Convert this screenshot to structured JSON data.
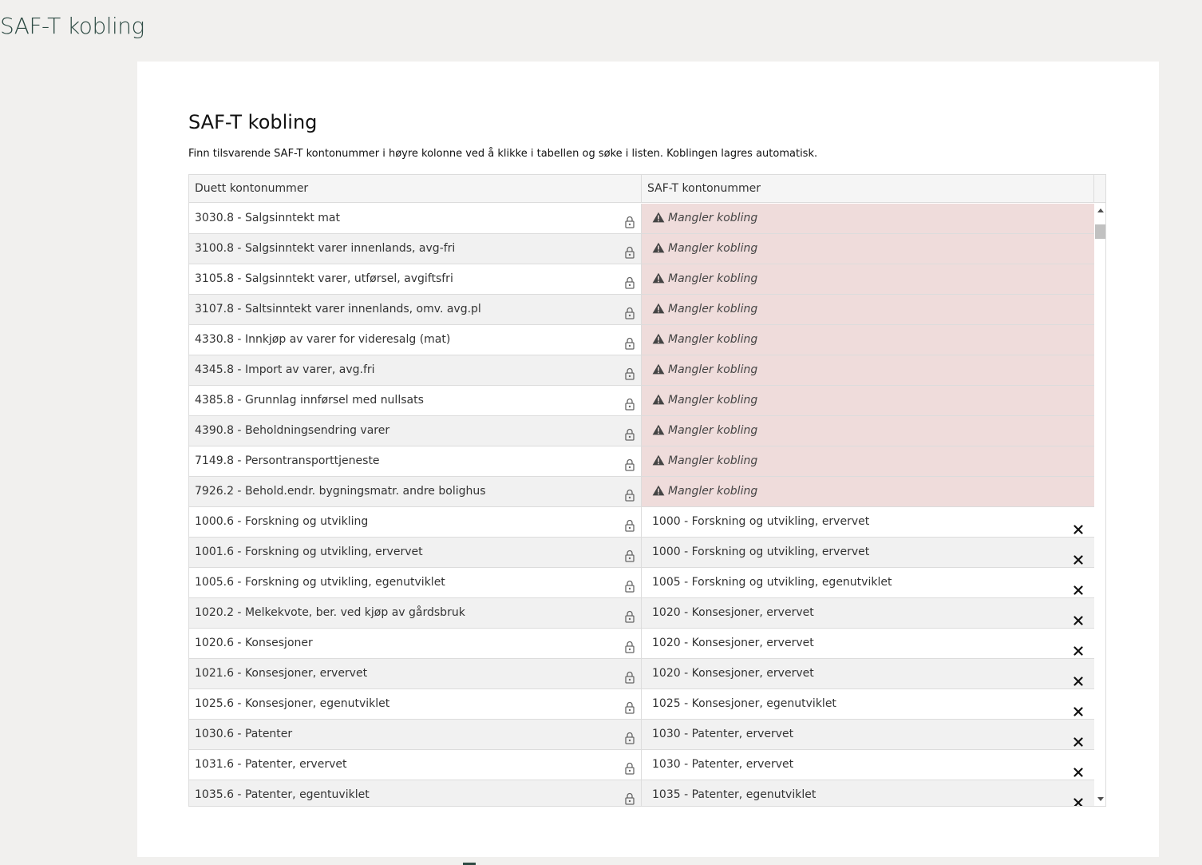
{
  "page": {
    "title": "SAF-T kobling"
  },
  "card": {
    "title": "SAF-T kobling",
    "description": "Finn tilsvarende SAF-T kontonummer i høyre kolonne ved å klikke i tabellen og søke i listen. Koblingen lagres automatisk."
  },
  "grid": {
    "columns": [
      "Duett kontonummer",
      "SAF-T kontonummer"
    ],
    "missing_label": "Mangler kobling",
    "colors": {
      "missing_bg": "#efdcdb",
      "row_alt_bg": "#f1f1f1",
      "header_bg": "#f5f5f5",
      "title_color": "#2e4b44"
    },
    "rows": [
      {
        "duett": "3030.8 - Salgsinntekt mat",
        "saft": ""
      },
      {
        "duett": "3100.8 - Salgsinntekt varer innenlands, avg-fri",
        "saft": ""
      },
      {
        "duett": "3105.8 - Salgsinntekt varer, utførsel, avgiftsfri",
        "saft": ""
      },
      {
        "duett": "3107.8 - Saltsinntekt varer innenlands, omv. avg.pl",
        "saft": ""
      },
      {
        "duett": "4330.8 - Innkjøp av varer for videresalg (mat)",
        "saft": ""
      },
      {
        "duett": "4345.8 - Import av varer, avg.fri",
        "saft": ""
      },
      {
        "duett": "4385.8 - Grunnlag innførsel med nullsats",
        "saft": ""
      },
      {
        "duett": "4390.8 - Beholdningsendring varer",
        "saft": ""
      },
      {
        "duett": "7149.8 - Persontransporttjeneste",
        "saft": ""
      },
      {
        "duett": "7926.2 - Behold.endr. bygningsmatr. andre bolighus",
        "saft": ""
      },
      {
        "duett": "1000.6 - Forskning og utvikling",
        "saft": "1000 - Forskning og utvikling, ervervet"
      },
      {
        "duett": "1001.6 - Forskning og utvikling, ervervet",
        "saft": "1000 - Forskning og utvikling, ervervet"
      },
      {
        "duett": "1005.6 - Forskning og utvikling, egenutviklet",
        "saft": "1005 - Forskning og utvikling, egenutviklet"
      },
      {
        "duett": "1020.2 - Melkekvote, ber. ved kjøp av gårdsbruk",
        "saft": "1020 - Konsesjoner, ervervet"
      },
      {
        "duett": "1020.6 - Konsesjoner",
        "saft": "1020 - Konsesjoner, ervervet"
      },
      {
        "duett": "1021.6 - Konsesjoner, ervervet",
        "saft": "1020 - Konsesjoner, ervervet"
      },
      {
        "duett": "1025.6 - Konsesjoner, egenutviklet",
        "saft": "1025 - Konsesjoner, egenutviklet"
      },
      {
        "duett": "1030.6 - Patenter",
        "saft": "1030 - Patenter, ervervet"
      },
      {
        "duett": "1031.6 - Patenter, ervervet",
        "saft": "1030 - Patenter, ervervet"
      },
      {
        "duett": "1035.6 - Patenter, egentuviklet",
        "saft": "1035 - Patenter, egenutviklet"
      }
    ]
  }
}
